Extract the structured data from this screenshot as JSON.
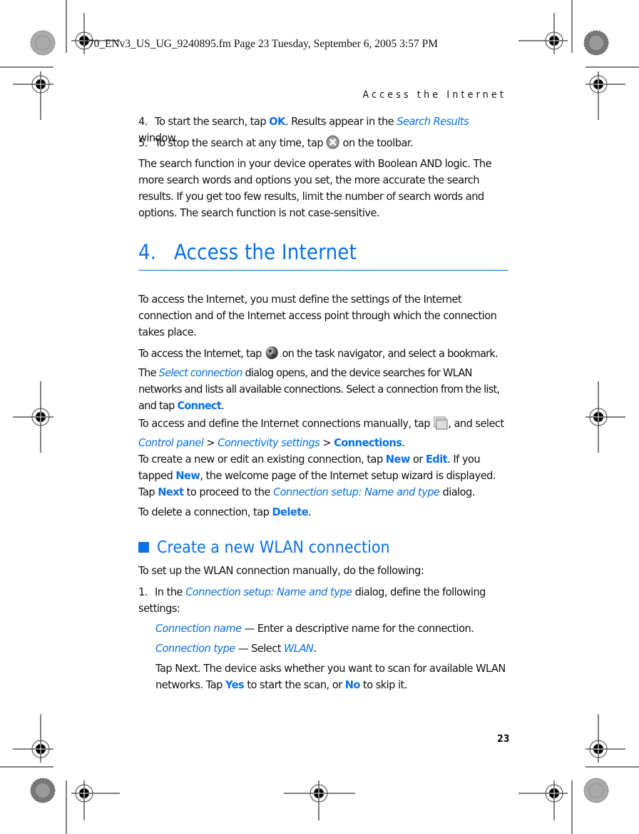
{
  "slug": "770_ENv3_US_UG_9240895.fm  Page 23  Tuesday, September 6, 2005  3:57 PM",
  "running_head": "Access the Internet",
  "steps_top": [
    {
      "num": "4.",
      "pre": "To start the search, tap ",
      "b1": "OK",
      "mid": ". Results appear in the ",
      "i1": "Search Results",
      "post": " window."
    },
    {
      "num": "5.",
      "pre": "To stop the search at any time, tap ",
      "icon": "stop-icon",
      "post": " on the toolbar."
    }
  ],
  "boolean_paragraph": "The search function in your device operates with Boolean AND logic. The more search words and options you set, the more accurate the search results. If you get too few results, limit the number of search words and options. The search function is not case-sensitive.",
  "chapter": {
    "number": "4.",
    "title": "Access the Internet"
  },
  "intro_paragraph": "To access the Internet, you must define the settings of the Internet connection and of the Internet access point through which the connection takes place.",
  "p_access": {
    "pre": "To access the Internet, tap ",
    "icon": "globe-icon",
    "mid1": " on the task navigator, and select a bookmark. The ",
    "i1": "Select connection",
    "mid2": " dialog opens, and the device searches for WLAN networks and lists all available connections. Select a connection from the list, and tap ",
    "b1": "Connect",
    "post": "."
  },
  "p_manual": {
    "pre": "To access and define the Internet connections manually, tap ",
    "icon": "window-icon",
    "mid1": ", and select ",
    "i1": "Control panel",
    "sep1": " > ",
    "i2": "Connectivity settings",
    "sep2": " > ",
    "b1": "Connections",
    "post": "."
  },
  "p_create": {
    "pre": "To create a new or edit an existing connection, tap ",
    "b1": "New",
    "mid1": " or ",
    "b2": "Edit",
    "mid2": ". If you tapped ",
    "b3": "New",
    "mid3": ", the welcome page of the Internet setup wizard is displayed. Tap ",
    "b4": "Next",
    "mid4": " to proceed to the ",
    "i1": "Connection setup: Name and type",
    "post": " dialog."
  },
  "p_delete": {
    "pre": "To delete a connection, tap ",
    "b1": "Delete",
    "post": "."
  },
  "section": {
    "title": "Create a new WLAN connection"
  },
  "section_intro": "To set up the WLAN connection manually, do the following:",
  "step1": {
    "num": "1.",
    "pre": "In the ",
    "i1": "Connection setup: Name and type",
    "post": " dialog, define the following settings:"
  },
  "settings": [
    {
      "label": "Connection name",
      "dash": " — ",
      "text": "Enter a descriptive name for the connection."
    },
    {
      "label": "Connection type",
      "dash": " — ",
      "text_pre": "Select ",
      "value": "WLAN",
      "text_post": "."
    }
  ],
  "p_next": {
    "pre": "Tap Next. The device asks whether you want to scan for available WLAN networks. Tap ",
    "b1": "Yes",
    "mid": " to start the scan, or ",
    "b2": "No",
    "post": " to skip it."
  },
  "page_number": "23",
  "colors": {
    "accent": "#0a71e6",
    "text": "#111111"
  }
}
